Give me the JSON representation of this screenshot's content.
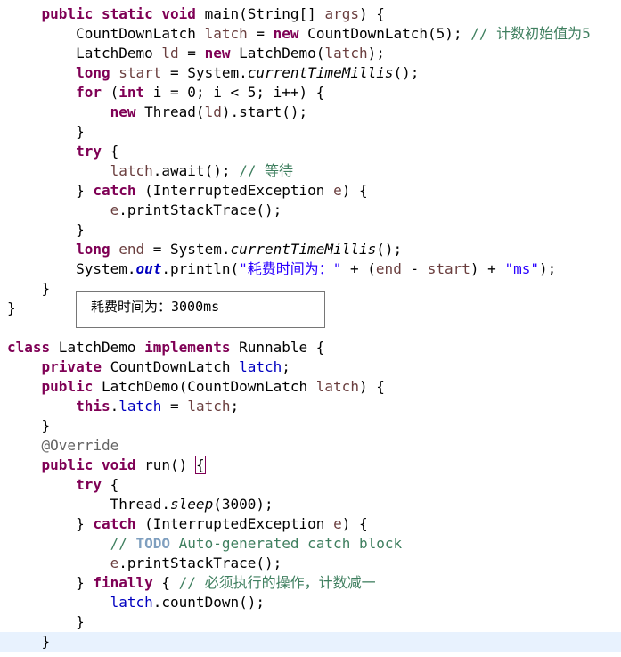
{
  "editor": {
    "main_signature": {
      "kw1": "public",
      "kw2": "static",
      "kw3": "void",
      "rest": "main(String[] ",
      "param": "args",
      "end": ") {"
    },
    "latch_decl": {
      "type": "CountDownLatch ",
      "var": "latch",
      "eq": " = ",
      "new": "new",
      "call": " CountDownLatch(5); ",
      "comment": "// 计数初始值为5"
    },
    "ld_decl": {
      "type": "LatchDemo ",
      "var": "ld",
      "eq": " = ",
      "new": "new",
      "call": " LatchDemo(",
      "arg": "latch",
      "end": ");"
    },
    "start_decl": {
      "kw": "long",
      "var": "start",
      "eq": " = System.",
      "method": "currentTimeMillis",
      "end": "();"
    },
    "for_line": {
      "kw": "for",
      "open": " (",
      "int_kw": "int",
      "rest": " i = 0; i < 5; i++) {"
    },
    "thread_line": {
      "new": "new",
      "call": " Thread(",
      "arg": "ld",
      "end": ").start();"
    },
    "close1": "}",
    "try1": {
      "kw": "try",
      "end": " {"
    },
    "await_line": {
      "var": "latch",
      "call": ".await(); ",
      "comment": "// 等待"
    },
    "catch1": {
      "open": "} ",
      "kw": "catch",
      "mid": " (InterruptedException ",
      "var": "e",
      "end": ") {"
    },
    "print1": {
      "var": "e",
      "call": ".printStackTrace();"
    },
    "close2": "}",
    "end_decl": {
      "kw": "long",
      "var": "end",
      "eq": " = System.",
      "method": "currentTimeMillis",
      "end": "();"
    },
    "println": {
      "a": "System.",
      "out": "out",
      "b": ".println(",
      "str1": "\"耗费时间为：\"",
      "c": " + (",
      "v1": "end",
      "d": " - ",
      "v2": "start",
      "e": ") + ",
      "str2": "\"ms\"",
      "f": ");"
    },
    "close_main": "}",
    "close_class": "}",
    "class_decl": {
      "kw1": "class",
      "name": " LatchDemo ",
      "kw2": "implements",
      "rest": " Runnable {"
    },
    "field_decl": {
      "kw": "private",
      "type": " CountDownLatch ",
      "field": "latch",
      "end": ";"
    },
    "ctor": {
      "kw": "public",
      "rest": " LatchDemo(CountDownLatch ",
      "param": "latch",
      "end": ") {"
    },
    "this_line": {
      "kw": "this",
      "dot": ".",
      "field": "latch",
      "eq": " = ",
      "param": "latch",
      "end": ";"
    },
    "close3": "}",
    "annotation": "@Override",
    "run_decl": {
      "kw1": "public",
      "kw2": "void",
      "rest": " run() ",
      "brace": "{"
    },
    "try2": {
      "kw": "try",
      "end": " {"
    },
    "sleep_line": {
      "a": "Thread.",
      "method": "sleep",
      "b": "(3000);"
    },
    "catch2": {
      "open": "} ",
      "kw": "catch",
      "mid": " (InterruptedException ",
      "var": "e",
      "end": ") {"
    },
    "todo_line": {
      "c1": "// ",
      "todo": "TODO",
      "c2": " Auto-generated catch block"
    },
    "print2": {
      "var": "e",
      "call": ".printStackTrace();"
    },
    "finally_line": {
      "open": "} ",
      "kw": "finally",
      "mid": " { ",
      "comment": "// 必须执行的操作，计数减一"
    },
    "countdown_line": {
      "field": "latch",
      "call": ".countDown();"
    },
    "close4": "}",
    "close_run": "}"
  },
  "tooltip": {
    "text": "耗费时间为：3000ms"
  }
}
